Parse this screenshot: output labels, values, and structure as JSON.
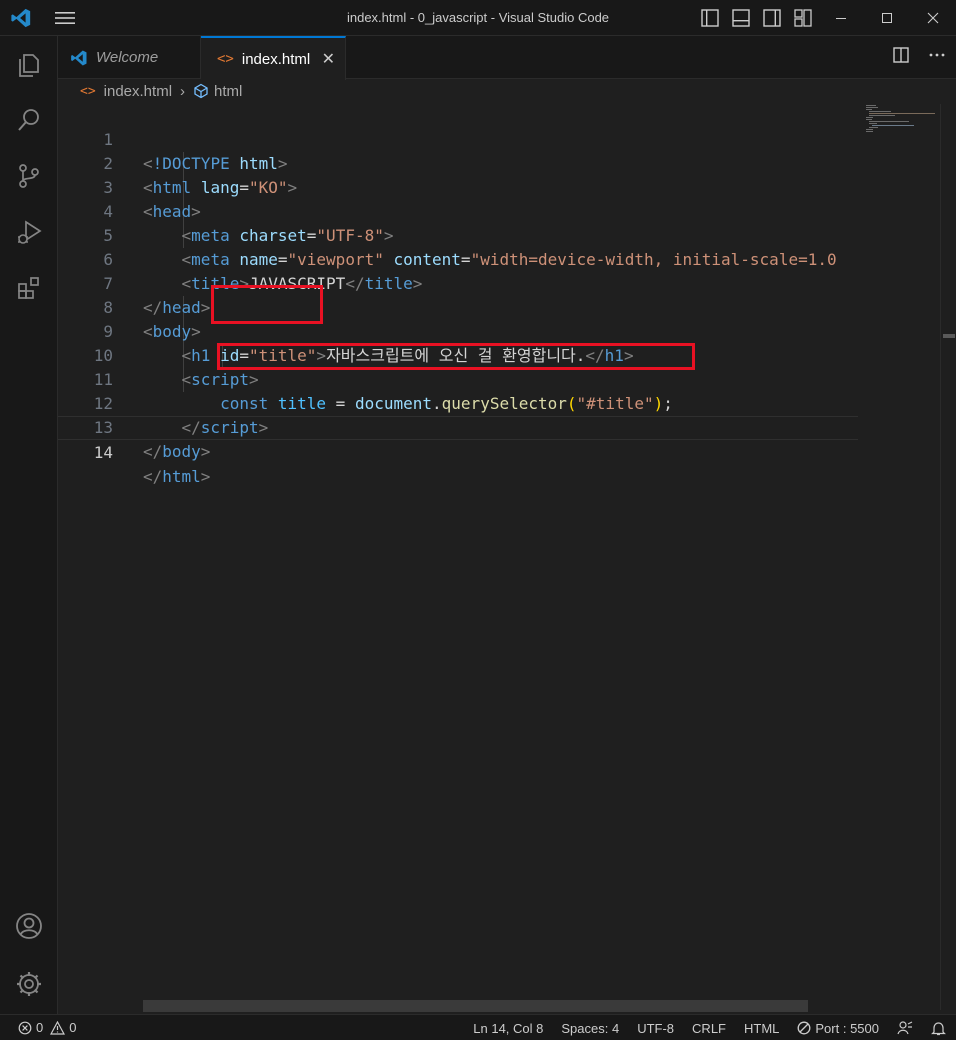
{
  "window": {
    "title": "index.html - 0_javascript - Visual Studio Code"
  },
  "tabs": [
    {
      "label": "Welcome",
      "icon": "vscode-logo-icon"
    },
    {
      "label": "index.html",
      "icon": "html-file-icon",
      "active": true
    }
  ],
  "breadcrumb": {
    "file": "index.html",
    "symbol": "html"
  },
  "editor": {
    "current_line": 14,
    "lines": [
      {
        "n": "1"
      },
      {
        "n": "2"
      },
      {
        "n": "3"
      },
      {
        "n": "4"
      },
      {
        "n": "5"
      },
      {
        "n": "6"
      },
      {
        "n": "7"
      },
      {
        "n": "8"
      },
      {
        "n": "9"
      },
      {
        "n": "10"
      },
      {
        "n": "11"
      },
      {
        "n": "12"
      },
      {
        "n": "13"
      },
      {
        "n": "14"
      }
    ],
    "tokens": {
      "doctype": "!DOCTYPE",
      "html": "html",
      "lang_attr": "lang",
      "lang_val": "\"KO\"",
      "head": "head",
      "meta": "meta",
      "charset_attr": "charset",
      "charset_val": "\"UTF-8\"",
      "name_attr": "name",
      "name_val": "\"viewport\"",
      "content_attr": "content",
      "content_val": "\"width=device-width, initial-scale=1.0",
      "title": "title",
      "title_text": "JAVASCRIPT",
      "body": "body",
      "h1": "h1",
      "id_attr": "id",
      "id_val": "\"title\"",
      "h1_text": "자바스크립트에 오신 걸 환영합니다.",
      "script": "script",
      "const": "const",
      "var_title": "title",
      "eq": " = ",
      "document": "document",
      "query": "querySelector",
      "sel": "\"#title\""
    }
  },
  "status": {
    "errors": "0",
    "warnings": "0",
    "position": "Ln 14, Col 8",
    "spaces": "Spaces: 4",
    "encoding": "UTF-8",
    "eol": "CRLF",
    "language": "HTML",
    "port": "Port : 5500"
  },
  "colors": {
    "accent": "#0078d4",
    "highlight_box": "#e81123"
  }
}
